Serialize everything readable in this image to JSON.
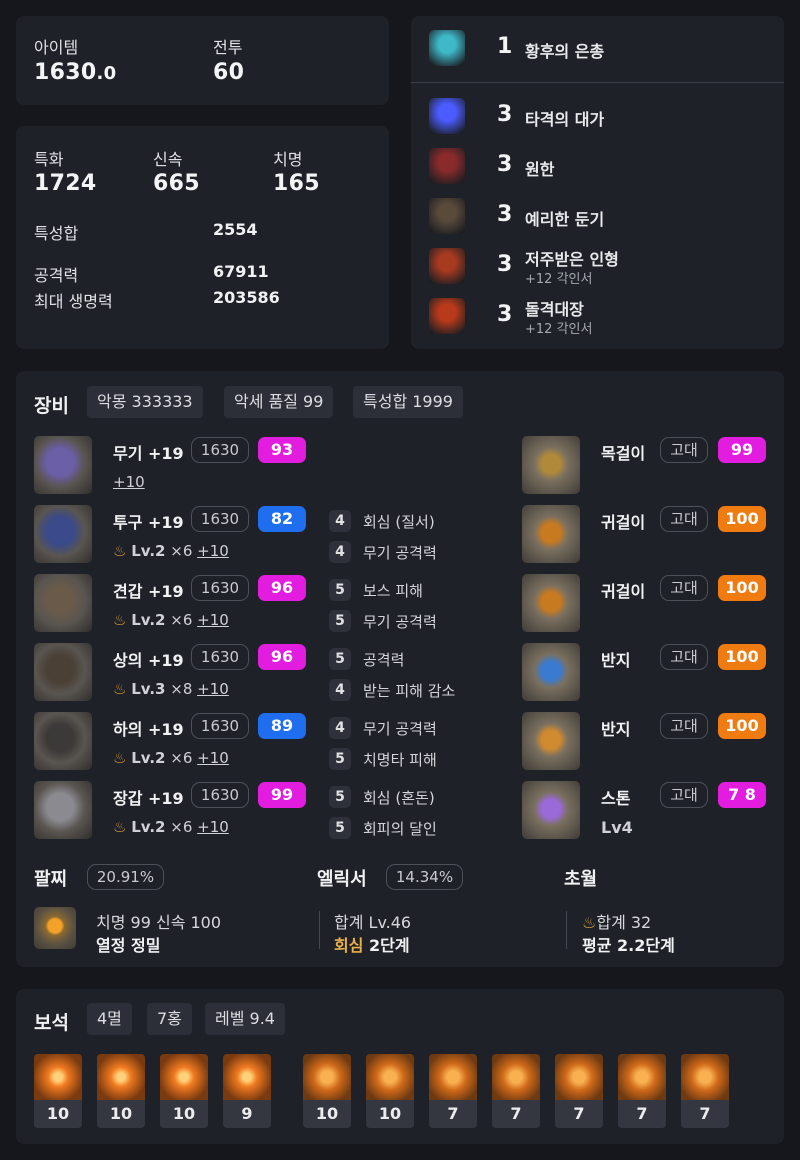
{
  "summary": {
    "item_label": "아이템",
    "item_value": "1630",
    "item_decimal": ".0",
    "combat_label": "전투",
    "combat_value": "60"
  },
  "stats": {
    "crit_spec_label": "특화",
    "crit_spec_value": "1724",
    "swift_label": "신속",
    "swift_value": "665",
    "crit_label": "치명",
    "crit_value": "165",
    "total_label": "특성합",
    "total_value": "2554",
    "attack_label": "공격력",
    "attack_value": "67911",
    "hp_label": "최대 생명력",
    "hp_value": "203586"
  },
  "engravings": [
    {
      "level": "1",
      "name": "황후의 은총",
      "sub": "",
      "color": "#3fb8c8"
    },
    {
      "level": "3",
      "name": "타격의 대가",
      "sub": "",
      "color": "#4a5cff"
    },
    {
      "level": "3",
      "name": "원한",
      "sub": "",
      "color": "#8a2a2a"
    },
    {
      "level": "3",
      "name": "예리한 둔기",
      "sub": "",
      "color": "#5a4a3a"
    },
    {
      "level": "3",
      "name": "저주받은 인형",
      "sub": "+12 각인서",
      "color": "#a83a20"
    },
    {
      "level": "3",
      "name": "돌격대장",
      "sub": "+12 각인서",
      "color": "#b83a1a"
    }
  ],
  "equipment_header": {
    "title": "장비",
    "badges": [
      "악몽 333333",
      "악세 품질 99",
      "특성합 1999"
    ]
  },
  "equipment": [
    {
      "name": "무기 +19",
      "ilvl": "1630",
      "quality": "93",
      "quality_color": "#e21de0",
      "sub_level": "",
      "sub_count": "",
      "sub_plus": "+10",
      "effects": []
    },
    {
      "name": "투구 +19",
      "ilvl": "1630",
      "quality": "82",
      "quality_color": "#1f6ef0",
      "sub_level": "Lv.2",
      "sub_count": "×6",
      "sub_plus": "+10",
      "effects": [
        {
          "n": "4",
          "t": "회심 (질서)"
        },
        {
          "n": "4",
          "t": "무기 공격력"
        }
      ]
    },
    {
      "name": "견갑 +19",
      "ilvl": "1630",
      "quality": "96",
      "quality_color": "#e21de0",
      "sub_level": "Lv.2",
      "sub_count": "×6",
      "sub_plus": "+10",
      "effects": [
        {
          "n": "5",
          "t": "보스 피해"
        },
        {
          "n": "5",
          "t": "무기 공격력"
        }
      ]
    },
    {
      "name": "상의 +19",
      "ilvl": "1630",
      "quality": "96",
      "quality_color": "#e21de0",
      "sub_level": "Lv.3",
      "sub_count": "×8",
      "sub_plus": "+10",
      "effects": [
        {
          "n": "5",
          "t": "공격력"
        },
        {
          "n": "4",
          "t": "받는 피해 감소"
        }
      ]
    },
    {
      "name": "하의 +19",
      "ilvl": "1630",
      "quality": "89",
      "quality_color": "#1f6ef0",
      "sub_level": "Lv.2",
      "sub_count": "×6",
      "sub_plus": "+10",
      "effects": [
        {
          "n": "4",
          "t": "무기 공격력"
        },
        {
          "n": "5",
          "t": "치명타 피해"
        }
      ]
    },
    {
      "name": "장갑 +19",
      "ilvl": "1630",
      "quality": "99",
      "quality_color": "#e21de0",
      "sub_level": "Lv.2",
      "sub_count": "×6",
      "sub_plus": "+10",
      "effects": [
        {
          "n": "5",
          "t": "회심 (혼돈)"
        },
        {
          "n": "5",
          "t": "회피의 달인"
        }
      ]
    }
  ],
  "accessories": [
    {
      "name": "목걸이",
      "grade": "고대",
      "quality": "99",
      "quality_color": "#e21de0",
      "sub": ""
    },
    {
      "name": "귀걸이",
      "grade": "고대",
      "quality": "100",
      "quality_color": "#f07b10",
      "sub": ""
    },
    {
      "name": "귀걸이",
      "grade": "고대",
      "quality": "100",
      "quality_color": "#f07b10",
      "sub": ""
    },
    {
      "name": "반지",
      "grade": "고대",
      "quality": "100",
      "quality_color": "#f07b10",
      "sub": ""
    },
    {
      "name": "반지",
      "grade": "고대",
      "quality": "100",
      "quality_color": "#f07b10",
      "sub": ""
    },
    {
      "name": "스톤",
      "grade": "고대",
      "quality": "7 8",
      "quality_color": "#e21de0",
      "sub": "Lv4"
    }
  ],
  "bracelet": {
    "title": "팔찌",
    "percent": "20.91%",
    "line1": "치명 99  신속 100",
    "line2": "열정  정밀"
  },
  "elixir": {
    "title": "엘릭서",
    "percent": "14.34%",
    "line1": "합계 Lv.46",
    "line2_accent": "회심",
    "line2_rest": "  2단계"
  },
  "transcend": {
    "title": "초월",
    "line1": "합계 32",
    "line2": "평균 2.2단계"
  },
  "gems": {
    "title": "보석",
    "badges": [
      "4멸",
      "7홍",
      "레벨 9.4"
    ],
    "items": [
      {
        "level": "10",
        "type": "멸"
      },
      {
        "level": "10",
        "type": "멸"
      },
      {
        "level": "10",
        "type": "멸"
      },
      {
        "level": "9",
        "type": "멸"
      },
      {
        "level": "10",
        "type": "홍"
      },
      {
        "level": "10",
        "type": "홍"
      },
      {
        "level": "7",
        "type": "홍"
      },
      {
        "level": "7",
        "type": "홍"
      },
      {
        "level": "7",
        "type": "홍"
      },
      {
        "level": "7",
        "type": "홍"
      },
      {
        "level": "7",
        "type": "홍"
      }
    ]
  },
  "colors": {
    "legendary_orange": "#f07b10",
    "relic_magenta": "#e21de0",
    "epic_blue": "#1f6ef0",
    "elixir_gold": "#e8b04a"
  }
}
